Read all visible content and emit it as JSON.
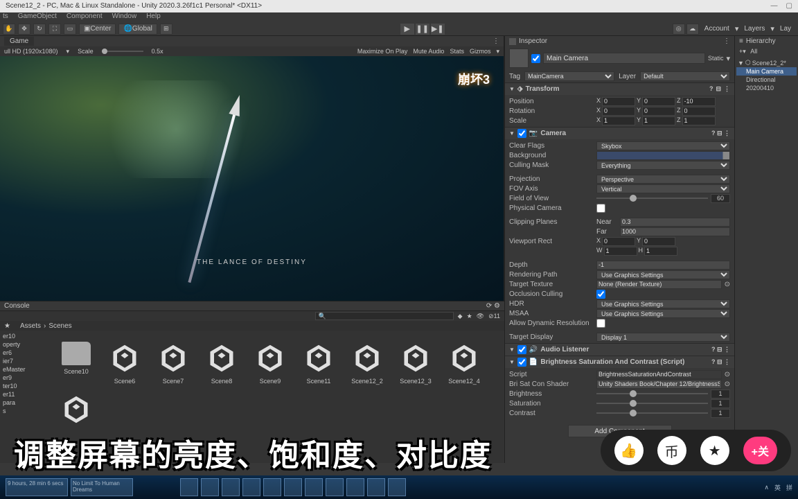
{
  "titlebar": {
    "title": "Scene12_2 - PC, Mac & Linux Standalone - Unity 2020.3.26f1c1 Personal* <DX11>"
  },
  "menu": [
    "ts",
    "GameObject",
    "Component",
    "Window",
    "Help"
  ],
  "toolbar": {
    "center": "Center",
    "global": "Global",
    "account": "Account",
    "layers": "Layers",
    "layout": "Lay"
  },
  "game": {
    "tab": "Game",
    "res": "ull HD (1920x1080)",
    "scale_label": "Scale",
    "scale_value": "0.5x",
    "options": [
      "Maximize On Play",
      "Mute Audio",
      "Stats",
      "Gizmos"
    ],
    "logo": "崩坏3",
    "caption": "THE LANCE OF DESTINY"
  },
  "console": {
    "tab": "Console"
  },
  "project": {
    "breadcrumb": [
      "Assets",
      "Scenes"
    ],
    "sidebar": [
      "er10",
      "operty",
      "er6",
      "ier7",
      "eMaster",
      "er9",
      "ter10",
      "er11",
      "para",
      "s"
    ],
    "assets": [
      {
        "name": "Scene10",
        "type": "folder"
      },
      {
        "name": "Scene6",
        "type": "unity"
      },
      {
        "name": "Scene7",
        "type": "unity"
      },
      {
        "name": "Scene8",
        "type": "unity"
      },
      {
        "name": "Scene9",
        "type": "unity"
      },
      {
        "name": "Scene11",
        "type": "unity"
      },
      {
        "name": "Scene12_2",
        "type": "unity"
      },
      {
        "name": "Scene12_3",
        "type": "unity"
      },
      {
        "name": "Scene12_4",
        "type": "unity"
      }
    ],
    "count": "11"
  },
  "inspector": {
    "title": "Inspector",
    "object_name": "Main Camera",
    "static": "Static",
    "tag_label": "Tag",
    "tag_value": "MainCamera",
    "layer_label": "Layer",
    "layer_value": "Default",
    "transform": {
      "title": "Transform",
      "position": {
        "label": "Position",
        "x": "0",
        "y": "0",
        "z": "-10"
      },
      "rotation": {
        "label": "Rotation",
        "x": "0",
        "y": "0",
        "z": "0"
      },
      "scale": {
        "label": "Scale",
        "x": "1",
        "y": "1",
        "z": "1"
      }
    },
    "camera": {
      "title": "Camera",
      "clear_flags": {
        "label": "Clear Flags",
        "value": "Skybox"
      },
      "background": {
        "label": "Background"
      },
      "culling_mask": {
        "label": "Culling Mask",
        "value": "Everything"
      },
      "projection": {
        "label": "Projection",
        "value": "Perspective"
      },
      "fov_axis": {
        "label": "FOV Axis",
        "value": "Vertical"
      },
      "fov": {
        "label": "Field of View",
        "value": "60"
      },
      "physical": {
        "label": "Physical Camera"
      },
      "clipping": {
        "label": "Clipping Planes",
        "near_label": "Near",
        "near": "0.3",
        "far_label": "Far",
        "far": "1000"
      },
      "viewport": {
        "label": "Viewport Rect",
        "x": "0",
        "y": "0",
        "w": "1",
        "h": "1"
      },
      "depth": {
        "label": "Depth",
        "value": "-1"
      },
      "rendering_path": {
        "label": "Rendering Path",
        "value": "Use Graphics Settings"
      },
      "target_texture": {
        "label": "Target Texture",
        "value": "None (Render Texture)"
      },
      "occlusion": {
        "label": "Occlusion Culling"
      },
      "hdr": {
        "label": "HDR",
        "value": "Use Graphics Settings"
      },
      "msaa": {
        "label": "MSAA",
        "value": "Use Graphics Settings"
      },
      "dynamic_res": {
        "label": "Allow Dynamic Resolution"
      },
      "target_display": {
        "label": "Target Display",
        "value": "Display 1"
      }
    },
    "audio": {
      "title": "Audio Listener"
    },
    "bsc": {
      "title": "Brightness Saturation And Contrast (Script)",
      "script": {
        "label": "Script",
        "value": "BrightnessSaturationAndContrast"
      },
      "shader": {
        "label": "Bri Sat Con Shader",
        "value": "Unity Shaders Book/Chapter 12/BrightnessSa"
      },
      "brightness": {
        "label": "Brightness",
        "value": "1"
      },
      "saturation": {
        "label": "Saturation",
        "value": "1"
      },
      "contrast": {
        "label": "Contrast",
        "value": "1"
      }
    },
    "add_component": "Add Component"
  },
  "hierarchy": {
    "title": "Hierarchy",
    "all": "All",
    "scene": "Scene12_2*",
    "items": [
      "Main Camera",
      "Directional",
      "20200410"
    ]
  },
  "overlay": {
    "text": "调整屏幕的亮度、饱和度、对比度",
    "follow": "+关"
  },
  "taskbar": {
    "time_hint": "9 hours, 28 min 6 secs",
    "slogan": "No Limit To Human Dreams",
    "tray": [
      "∧",
      "英",
      "拼"
    ]
  }
}
